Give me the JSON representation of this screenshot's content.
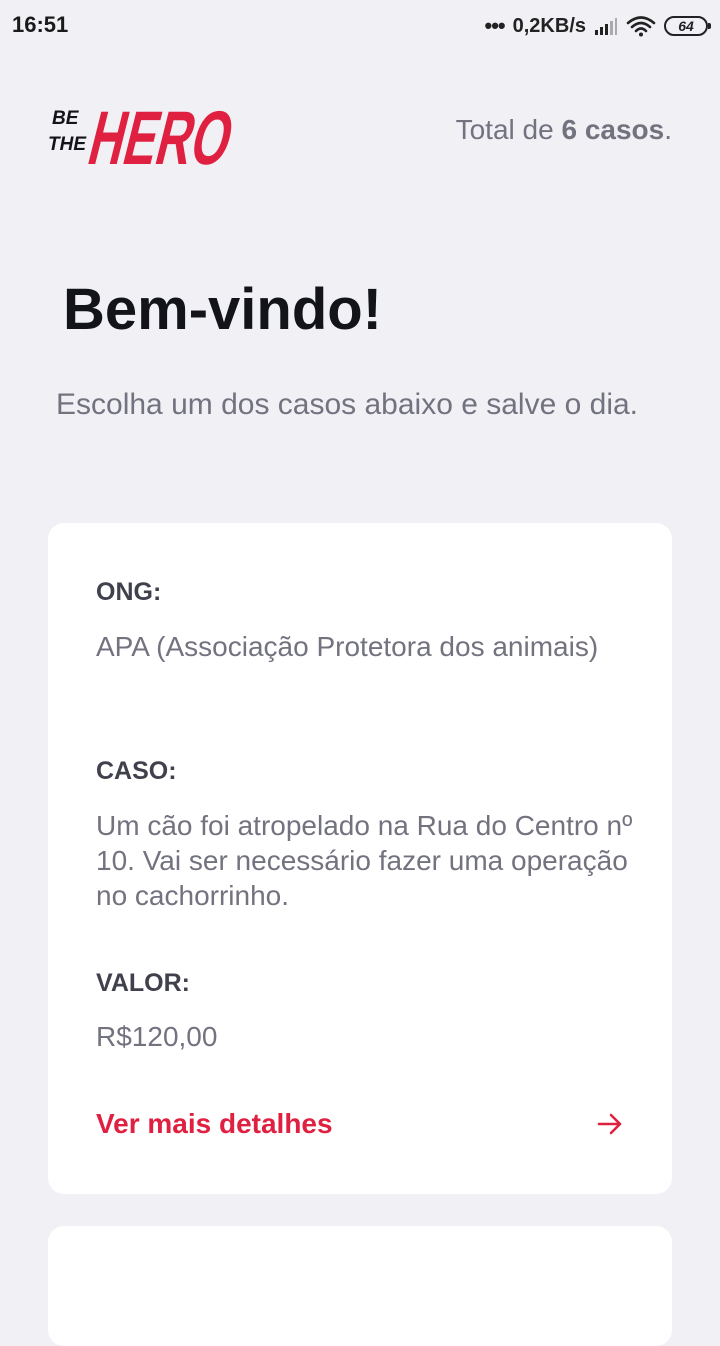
{
  "status_bar": {
    "time": "16:51",
    "dots": "•••",
    "network_speed": "0,2KB/s",
    "battery_level": "64"
  },
  "header": {
    "logo": {
      "line1": "BE",
      "line2": "THE",
      "word": "HERO",
      "color": "#e02041"
    },
    "total_prefix": "Total de",
    "total_count": "6 casos",
    "total_suffix": "."
  },
  "main": {
    "title": "Bem-vindo!",
    "subtitle": "Escolha um dos casos abaixo e salve o dia."
  },
  "incidents": [
    {
      "ong_label": "ONG:",
      "ong_value": "APA (Associação Protetora dos animais)",
      "caso_label": "CASO:",
      "caso_value": "Um cão foi atropelado na Rua do Centro nº 10. Vai ser necessário fazer uma operação no cachorrinho.",
      "valor_label": "VALOR:",
      "valor_value": "R$120,00",
      "details_label": "Ver mais detalhes",
      "details_icon": "arrow-right-icon"
    }
  ],
  "colors": {
    "accent": "#e02041",
    "background": "#f0f0f5",
    "title": "#13131a",
    "label": "#41414d",
    "text": "#737380"
  }
}
